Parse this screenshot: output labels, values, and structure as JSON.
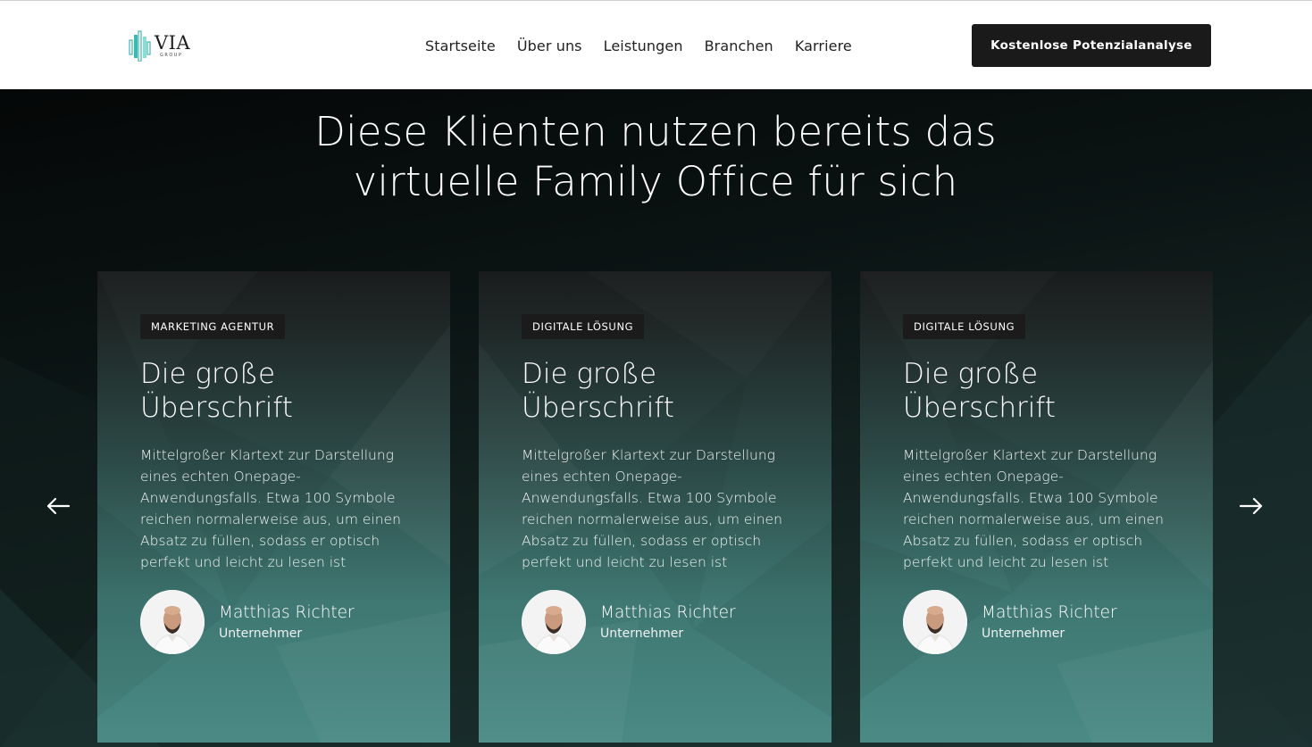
{
  "header": {
    "logo": {
      "main": "VIA",
      "sub": "GROUP"
    },
    "nav": [
      "Startseite",
      "Über uns",
      "Leistungen",
      "Branchen",
      "Karriere"
    ],
    "cta": "Kostenlose Potenzialanalyse"
  },
  "hero": {
    "title_line1": "Diese Klienten nutzen bereits das",
    "title_line2": "virtuelle Family Office für sich"
  },
  "cards": [
    {
      "badge": "MARKETING AGENTUR",
      "title_line1": "Die große",
      "title_line2": "Überschrift",
      "text": "Mittelgroßer Klartext zur Darstellung eines echten Onepage-Anwendungsfalls. Etwa 100 Symbole reichen normalerweise aus, um einen Absatz zu füllen, sodass er optisch perfekt und leicht zu lesen ist",
      "author_name": "Matthias Richter",
      "author_role": "Unternehmer"
    },
    {
      "badge": "DIGITALE LÖSUNG",
      "title_line1": "Die große",
      "title_line2": "Überschrift",
      "text": "Mittelgroßer Klartext zur Darstellung eines echten Onepage-Anwendungsfalls. Etwa 100 Symbole reichen normalerweise aus, um einen Absatz zu füllen, sodass er optisch perfekt und leicht zu lesen ist",
      "author_name": "Matthias Richter",
      "author_role": "Unternehmer"
    },
    {
      "badge": "DIGITALE LÖSUNG",
      "title_line1": "Die große",
      "title_line2": "Überschrift",
      "text": "Mittelgroßer Klartext zur Darstellung eines echten Onepage-Anwendungsfalls. Etwa 100 Symbole reichen normalerweise aus, um einen Absatz zu füllen, sodass er optisch perfekt und leicht zu lesen ist",
      "author_name": "Matthias Richter",
      "author_role": "Unternehmer"
    }
  ],
  "carousel": {
    "prev_icon": "arrow-left-icon",
    "next_icon": "arrow-right-icon"
  },
  "colors": {
    "header_bg": "#ffffff",
    "cta_bg": "#1a1a1a",
    "hero_bg_dark": "#050707",
    "card_teal": "#4a8a85",
    "logo_teal": "#3fb8ad"
  }
}
